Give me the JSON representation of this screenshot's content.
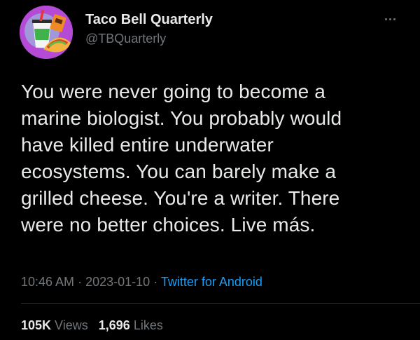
{
  "author": {
    "name": "Taco Bell Quarterly",
    "handle": "@TBQuarterly",
    "avatar_icon": "taco-bell-cup-and-taco-avatar",
    "avatar_bg": "#b54ad6"
  },
  "tweet": {
    "text": "You were never going to become a\nmarine biologist. You probably would\nhave killed entire underwater\necosystems. You can barely make a\ngrilled cheese. You're a writer. There\nwere no better choices. Live más."
  },
  "meta": {
    "time": "10:46 AM",
    "separator": "·",
    "date": "2023-01-10",
    "source": "Twitter for Android"
  },
  "stats": {
    "views_count": "105K",
    "views_label": "Views",
    "likes_count": "1,696",
    "likes_label": "Likes"
  },
  "colors": {
    "background": "#000000",
    "text": "#e7e9ea",
    "secondary": "#71767b",
    "link": "#1d9bf0"
  },
  "icons": {
    "more": "more-options-icon"
  }
}
